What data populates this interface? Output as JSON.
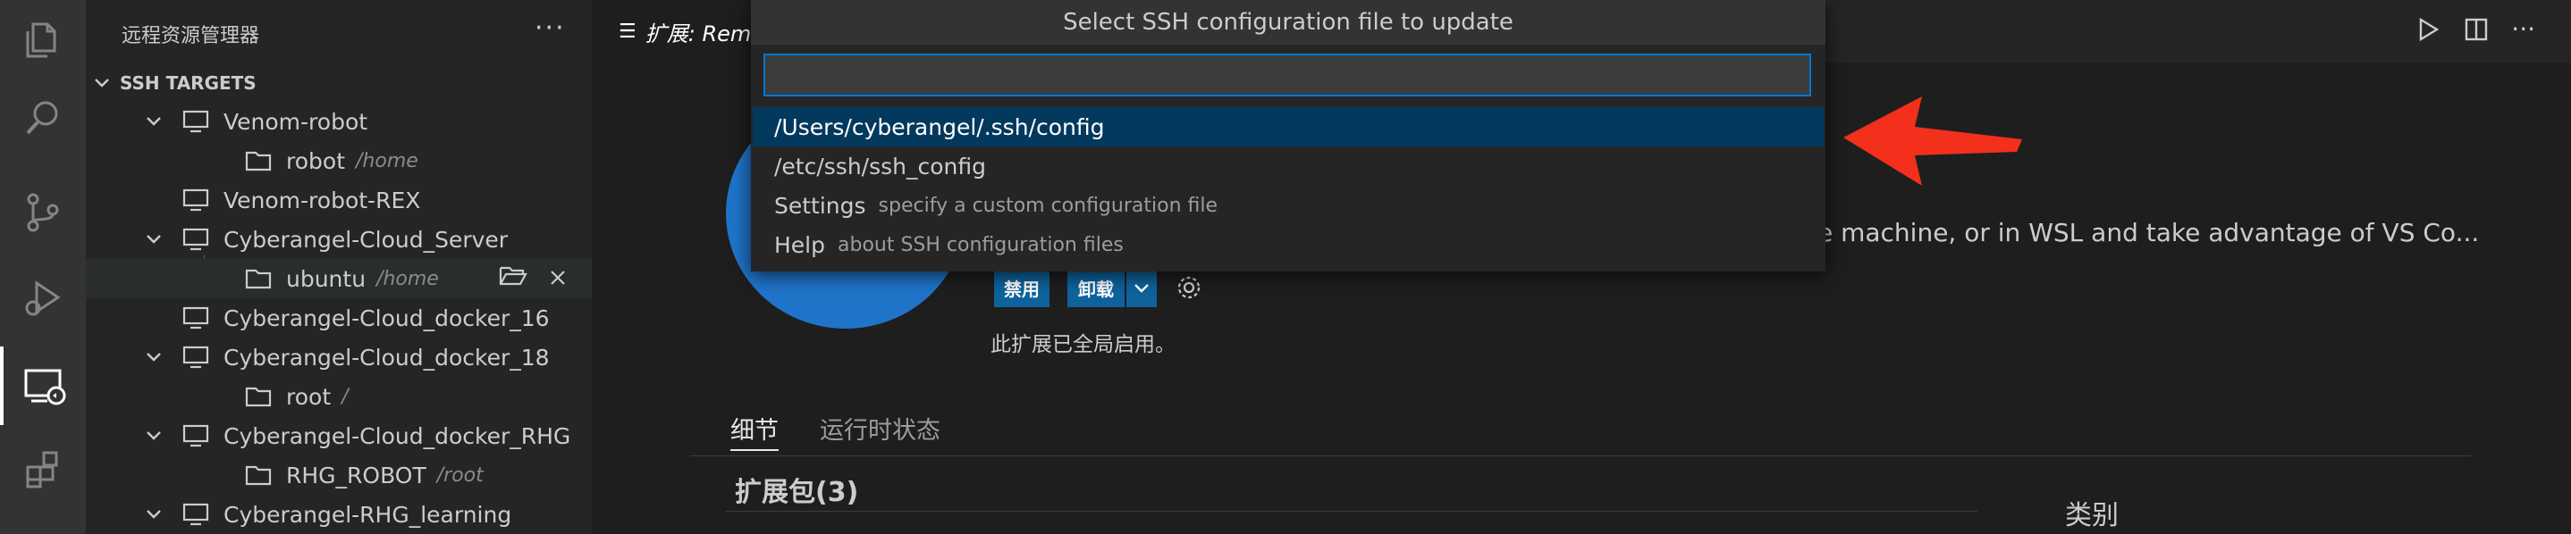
{
  "sidebar": {
    "title": "远程资源管理器",
    "more_label": "···",
    "section": "SSH TARGETS",
    "rows": [
      {
        "name": "Venom-robot"
      },
      {
        "name": "robot",
        "sub": "/home"
      },
      {
        "name": "Venom-robot-REX"
      },
      {
        "name": "Cyberangel-Cloud_Server"
      },
      {
        "name": "ubuntu",
        "sub": "/home"
      },
      {
        "name": "Cyberangel-Cloud_docker_16"
      },
      {
        "name": "Cyberangel-Cloud_docker_18"
      },
      {
        "name": "root",
        "sub": "/"
      },
      {
        "name": "Cyberangel-Cloud_docker_RHG"
      },
      {
        "name": "RHG_ROBOT",
        "sub": "/root"
      },
      {
        "name": "Cyberangel-RHG_learning"
      }
    ]
  },
  "editor": {
    "tab_label": "扩展: Rem",
    "description": "te machine, or in WSL and take advantage of VS Co...",
    "disable_label": "禁用",
    "uninstall_label": "卸载",
    "enabled_text": "此扩展已全局启用。",
    "tabs": [
      "细节",
      "运行时状态"
    ],
    "pack_heading": "扩展包(3)",
    "category_heading": "类别"
  },
  "quick_pick": {
    "title": "Select SSH configuration file to update",
    "input_value": "",
    "items": [
      {
        "label": "/Users/cyberangel/.ssh/config",
        "desc": ""
      },
      {
        "label": "/etc/ssh/ssh_config",
        "desc": ""
      },
      {
        "label": "Settings",
        "desc": "specify a custom configuration file"
      },
      {
        "label": "Help",
        "desc": "about SSH configuration files"
      }
    ]
  },
  "colors": {
    "accent": "#0078d4",
    "selection": "#04395e",
    "arrow": "#f2301b",
    "button": "#0e639c"
  }
}
